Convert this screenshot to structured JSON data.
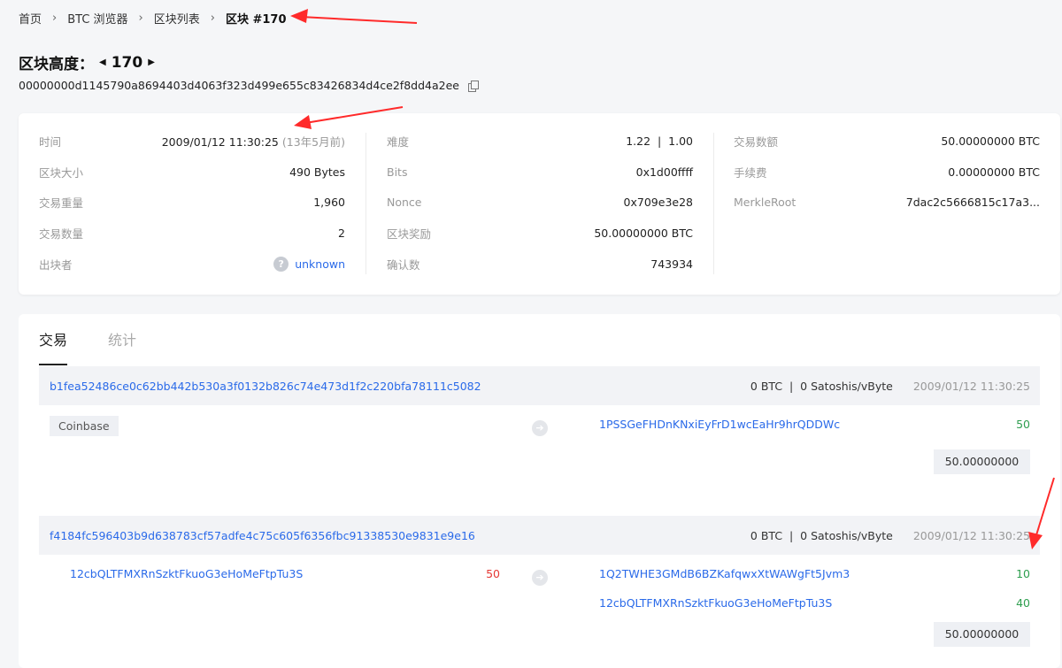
{
  "breadcrumb": {
    "items": [
      "首页",
      "BTC 浏览器",
      "区块列表"
    ],
    "current": "区块 #170"
  },
  "block": {
    "title_label": "区块高度：",
    "height": "170",
    "hash": "00000000d1145790a8694403d4063f323d499e655c83426834d4ce2f8dd4a2ee"
  },
  "info": {
    "col1": [
      {
        "label": "时间",
        "value": "2009/01/12 11:30:25",
        "extra": "(13年5月前)"
      },
      {
        "label": "区块大小",
        "value": "490 Bytes"
      },
      {
        "label": "交易重量",
        "value": "1,960"
      },
      {
        "label": "交易数量",
        "value": "2"
      },
      {
        "label": "出块者",
        "value": "unknown"
      }
    ],
    "col2": [
      {
        "label": "难度",
        "value": "1.22  |  1.00"
      },
      {
        "label": "Bits",
        "value": "0x1d00ffff"
      },
      {
        "label": "Nonce",
        "value": "0x709e3e28"
      },
      {
        "label": "区块奖励",
        "value": "50.00000000 BTC"
      },
      {
        "label": "确认数",
        "value": "743934"
      }
    ],
    "col3": [
      {
        "label": "交易数额",
        "value": "50.00000000 BTC"
      },
      {
        "label": "手续费",
        "value": "0.00000000 BTC"
      },
      {
        "label": "MerkleRoot",
        "value": "7dac2c5666815c17a3..."
      }
    ]
  },
  "tabs": [
    "交易",
    "统计"
  ],
  "transactions": [
    {
      "hash": "b1fea52486ce0c62bb442b530a3f0132b826c74e473d1f2c220bfa78111c5082",
      "fee": "0 BTC  |  0 Satoshis/vByte",
      "time": "2009/01/12 11:30:25",
      "input_label": "Coinbase",
      "outputs": [
        {
          "address": "1PSSGeFHDnKNxiEyFrD1wcEaHr9hrQDDWc",
          "amount": "50"
        }
      ],
      "total": "50.00000000"
    },
    {
      "hash": "f4184fc596403b9d638783cf57adfe4c75c605f6356fbc91338530e9831e9e16",
      "fee": "0 BTC  |  0 Satoshis/vByte",
      "time": "2009/01/12 11:30:25",
      "inputs": [
        {
          "address": "12cbQLTFMXRnSzktFkuoG3eHoMeFtpTu3S",
          "amount": "50"
        }
      ],
      "outputs": [
        {
          "address": "1Q2TWHE3GMdB6BZKafqwxXtWAWgFt5Jvm3",
          "amount": "10"
        },
        {
          "address": "12cbQLTFMXRnSzktFkuoG3eHoMeFtpTu3S",
          "amount": "40"
        }
      ],
      "total": "50.00000000"
    }
  ],
  "colors": {
    "link": "#2a6ae9",
    "input_amount": "#e53935",
    "output_amount": "#2e9e4f",
    "annotation_arrow": "#ff2a2a"
  }
}
